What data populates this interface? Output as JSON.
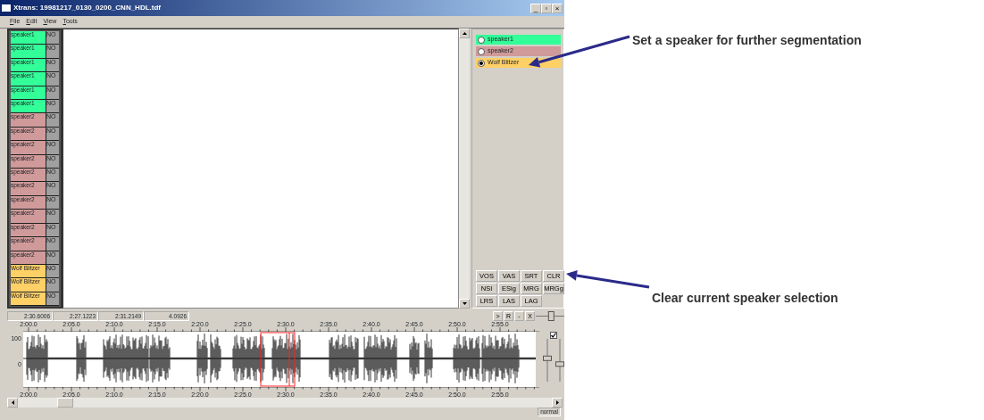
{
  "window": {
    "title": "Xtrans: 19981217_0130_0200_CNN_HDL.tdf",
    "controls": [
      "_",
      "▫",
      "×"
    ]
  },
  "menu": [
    "File",
    "Edit",
    "View",
    "Tools"
  ],
  "segments": [
    {
      "speaker": "speaker1",
      "tag": "NO",
      "color": "#33ff99"
    },
    {
      "speaker": "speaker1",
      "tag": "NO",
      "color": "#33ff99"
    },
    {
      "speaker": "speaker1",
      "tag": "NO",
      "color": "#33ff99"
    },
    {
      "speaker": "speaker1",
      "tag": "NO",
      "color": "#33ff99"
    },
    {
      "speaker": "speaker1",
      "tag": "NO",
      "color": "#33ff99"
    },
    {
      "speaker": "speaker1",
      "tag": "NO",
      "color": "#33ff99"
    },
    {
      "speaker": "speaker2",
      "tag": "NO",
      "color": "#d09a9a"
    },
    {
      "speaker": "speaker2",
      "tag": "NO",
      "color": "#d09a9a"
    },
    {
      "speaker": "speaker2",
      "tag": "NO",
      "color": "#d09a9a"
    },
    {
      "speaker": "speaker2",
      "tag": "NO",
      "color": "#d09a9a"
    },
    {
      "speaker": "speaker2",
      "tag": "NO",
      "color": "#d09a9a"
    },
    {
      "speaker": "speaker2",
      "tag": "NO",
      "color": "#d09a9a"
    },
    {
      "speaker": "speaker2",
      "tag": "NO",
      "color": "#d09a9a"
    },
    {
      "speaker": "speaker2",
      "tag": "NO",
      "color": "#d09a9a"
    },
    {
      "speaker": "speaker2",
      "tag": "NO",
      "color": "#d09a9a"
    },
    {
      "speaker": "speaker2",
      "tag": "NO",
      "color": "#d09a9a"
    },
    {
      "speaker": "speaker2",
      "tag": "NO",
      "color": "#d09a9a"
    },
    {
      "speaker": "Wolf Blitzer",
      "tag": "NO",
      "color": "#ffd066"
    },
    {
      "speaker": "Wolf Blitzer",
      "tag": "NO",
      "color": "#ffd066"
    },
    {
      "speaker": "Wolf Blitzer",
      "tag": "NO",
      "color": "#ffd066"
    }
  ],
  "speakers": [
    {
      "label": "speaker1",
      "color": "#33ff99",
      "selected": false
    },
    {
      "label": "speaker2",
      "color": "#d09a9a",
      "selected": false
    },
    {
      "label": "Wolf Blitzer",
      "color": "#ffd066",
      "selected": true
    }
  ],
  "buttons": [
    "VOS",
    "VAS",
    "SRT",
    "CLR",
    "NSI",
    "ESig",
    "MRG",
    "MRGg",
    "LRS",
    "LAS",
    "LAG"
  ],
  "times": [
    "2:30.6006",
    "2:27.1223",
    "2:31.2149",
    "4.0926"
  ],
  "playback_buttons": [
    ">",
    "R",
    "-",
    "X"
  ],
  "zoom_slider": {
    "level": 0.55
  },
  "top_ticks": [
    "2:00.0",
    "2:05.0",
    "2:10.0",
    "2:15.0",
    "2:20.0",
    "2:25.0",
    "2:30.0",
    "2:35.0",
    "2:40.0",
    "2:45.0",
    "2:50.0",
    "2:55.0"
  ],
  "bottom_ticks": [
    "2:00.0",
    "2:05.0",
    "2:10.0",
    "2:15.0",
    "2:20.0",
    "2:25.0",
    "2:30.0",
    "2:35.0",
    "2:40.0",
    "2:45.0",
    "2:50.0",
    "2:55.0"
  ],
  "waveform_sliders": [
    {
      "level": 0.55
    },
    {
      "level": 0.4
    }
  ],
  "amplitude_labels": [
    "100",
    "0"
  ],
  "waveform_checkbox": {
    "checked": true
  },
  "status": "normal",
  "annotations": [
    {
      "text": "Set a speaker for further segmentation"
    },
    {
      "text": "Clear current speaker selection"
    }
  ]
}
